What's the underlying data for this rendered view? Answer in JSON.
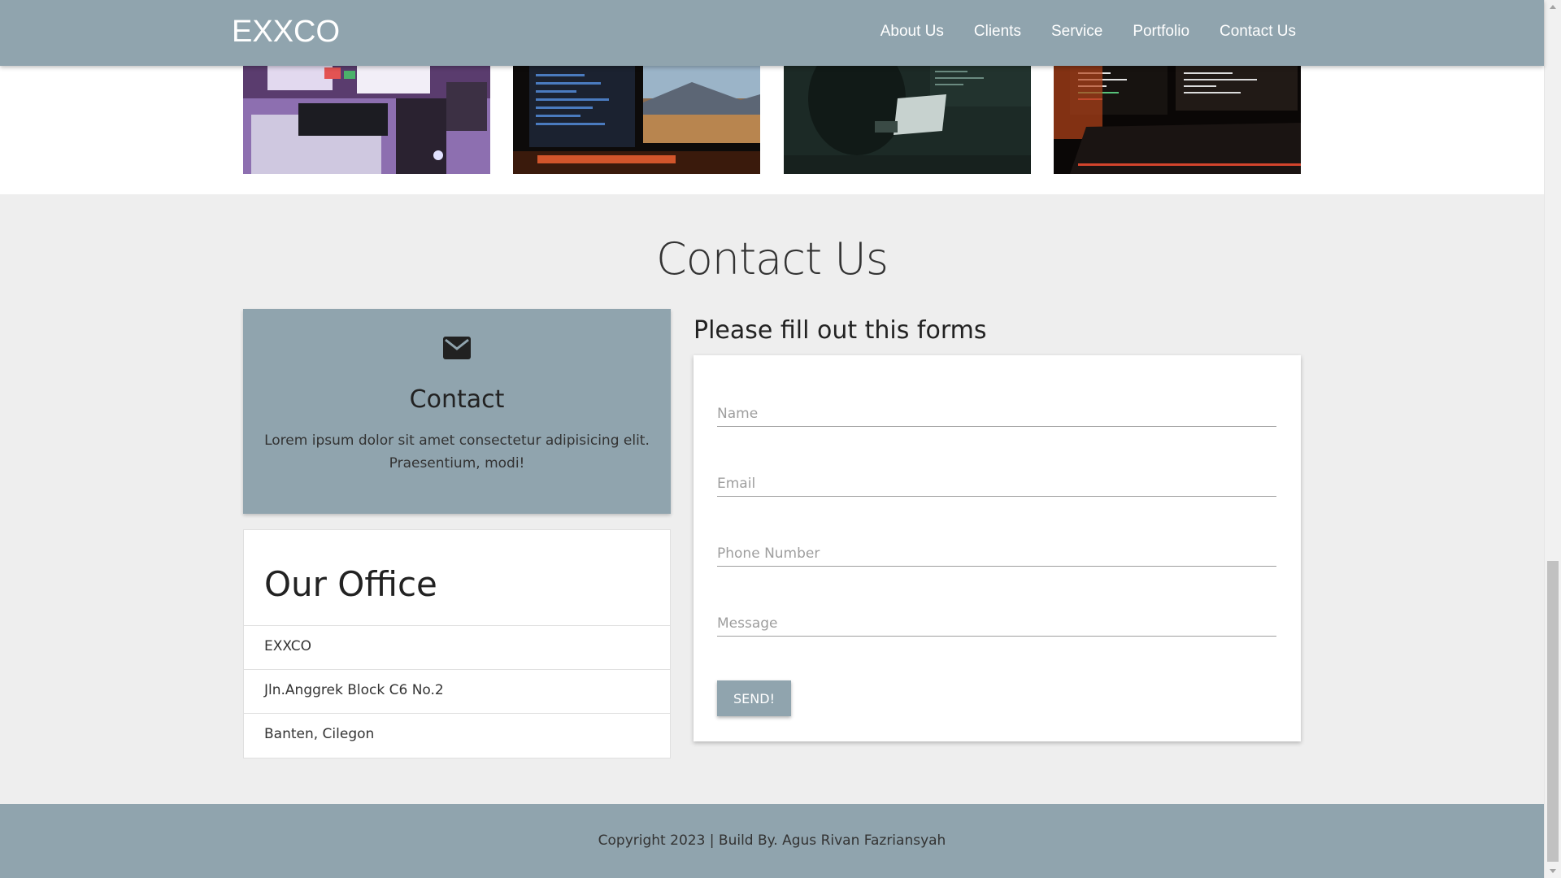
{
  "navbar": {
    "brand": "EXXCO",
    "links": [
      "About Us",
      "Clients",
      "Service",
      "Portfolio",
      "Contact Us"
    ]
  },
  "portfolio": {
    "images": [
      "desk-setup-image",
      "coding-monitors-image",
      "hacker-laptop-image",
      "code-keyboard-image"
    ]
  },
  "contact": {
    "section_title": "Contact Us",
    "card": {
      "icon": "mail-icon",
      "title": "Contact",
      "text": "Lorem ipsum dolor sit amet consectetur adipisicing elit. Praesentium, modi!"
    },
    "office": {
      "title": "Our Office",
      "items": [
        "EXXCO",
        "Jln.Anggrek Block C6 No.2",
        "Banten, Cilegon"
      ]
    },
    "form": {
      "heading": "Please fill out this forms",
      "name_placeholder": "Name",
      "email_placeholder": "Email",
      "phone_placeholder": "Phone Number",
      "message_placeholder": "Message",
      "send_label": "SEND!"
    }
  },
  "footer": {
    "text": "Copyright 2023 | Build By. Agus Rivan Fazriansyah"
  },
  "colors": {
    "primary": "#90a4ae",
    "background": "#eeeeee",
    "card": "#ffffff"
  }
}
